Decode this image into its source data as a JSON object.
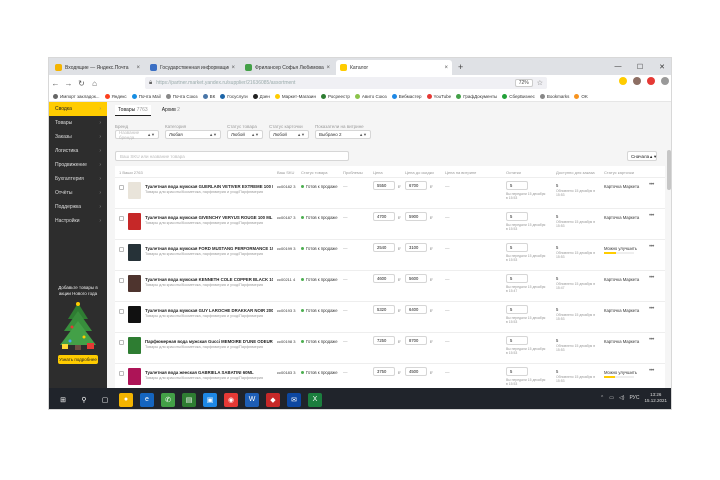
{
  "browser": {
    "tabs": [
      {
        "title": "Входящие — Яндекс.Почта",
        "color": "#f4b400"
      },
      {
        "title": "Государственная информационн",
        "color": "#3b6fc4"
      },
      {
        "title": "Фрилансер Софья Любимова",
        "color": "#43a047"
      },
      {
        "title": "Каталог",
        "color": "#ffcc00"
      }
    ],
    "new_tab": "+",
    "window_controls": [
      "—",
      "☐",
      "✕"
    ],
    "nav": {
      "back": "←",
      "forward": "→",
      "reload": "↻",
      "home": "⌂"
    },
    "url": "https://partner.market.yandex.ru/supplier/21636085/assortment",
    "zoom": "72%",
    "bookmarks": [
      {
        "label": "Импорт закладок...",
        "color": "#666"
      },
      {
        "label": "Яндекс",
        "color": "#fc3f1d"
      },
      {
        "label": "Почта Mail",
        "color": "#168de2"
      },
      {
        "label": "Почта Союз",
        "color": "#888"
      },
      {
        "label": "ВК",
        "color": "#4a76a8"
      },
      {
        "label": "Госуслуги",
        "color": "#1c65a8"
      },
      {
        "label": "Дзен",
        "color": "#222"
      },
      {
        "label": "Маркет-Магазин",
        "color": "#ffcc00"
      },
      {
        "label": "Росреестр",
        "color": "#2e7d32"
      },
      {
        "label": "Авито Союз",
        "color": "#8bc34a"
      },
      {
        "label": "Вебмастер",
        "color": "#1e88e5"
      },
      {
        "label": "YouTube",
        "color": "#e53935"
      },
      {
        "label": "ГрафДокументы",
        "color": "#43a047"
      },
      {
        "label": "СберБизнес",
        "color": "#21a038"
      },
      {
        "label": "Bookmarks",
        "color": "#888"
      },
      {
        "label": "OK",
        "color": "#f7931e"
      }
    ]
  },
  "sidebar": {
    "items": [
      {
        "label": "Сводка",
        "active": true
      },
      {
        "label": "Товары",
        "active": false
      },
      {
        "label": "Заказы",
        "active": false
      },
      {
        "label": "Логистика",
        "active": false
      },
      {
        "label": "Продвижение",
        "active": false
      },
      {
        "label": "Бухгалтерия",
        "active": false
      },
      {
        "label": "Отчёты",
        "active": false
      },
      {
        "label": "Поддержка",
        "active": false
      },
      {
        "label": "Настройки",
        "active": false
      }
    ],
    "promo_text": "Добавьте товары в акции Нового года",
    "promo_button": "Узнать подробнее"
  },
  "main": {
    "tabs": [
      {
        "label": "Товары",
        "count": "7763"
      },
      {
        "label": "Архив",
        "count": "2"
      }
    ],
    "filters": [
      {
        "label": "Бренд",
        "value": "Название бренда",
        "placeholder": true
      },
      {
        "label": "Категория",
        "value": "Любая",
        "placeholder": false
      },
      {
        "label": "Статус товара",
        "value": "Любой",
        "placeholder": false
      },
      {
        "label": "Статус карточки",
        "value": "Любой",
        "placeholder": false
      },
      {
        "label": "Показатели на витрине",
        "value": "Выбрано 2",
        "placeholder": false
      }
    ],
    "search_placeholder": "Ваш SKU или название товара",
    "sort": "Сначала",
    "columns": [
      "1 Ваши 2763",
      "Ваш SKU",
      "Статус товара",
      "Проблемы",
      "Цена",
      "Цена до скидки",
      "Цена на витрине",
      "Остатки",
      "Доступно для заказа",
      "Статус карточки"
    ],
    "rows": [
      {
        "name": "Туалетная вода мужская GUERLAIN VETIVER EXTREME 100 ML",
        "cat": "Товары для красоты/Косметика, парфюмерия и уход/Парфюмерия",
        "sku": "cc00182 3",
        "status": "Готов к продаже",
        "problem": "—",
        "price": "5550",
        "price_old": "6700",
        "rub": "₽",
        "qty": "—",
        "stock": "5",
        "stock_note": "Вы передали 15 декабря в 15:53",
        "avail": "5",
        "avail_note": "Обновлено 15 декабря в 15:53",
        "card": "Карточка Маркета",
        "progress": null,
        "thumb": "#e9e4da"
      },
      {
        "name": "Туалетная вода мужская GIVENCHY VERYUS ROUGE 100 ML",
        "cat": "Товары для красоты/Косметика, парфюмерия и уход/Парфюмерия",
        "sku": "cc00187 3",
        "status": "Готов к продаже",
        "problem": "—",
        "price": "4700",
        "price_old": "5900",
        "rub": "₽",
        "qty": "—",
        "stock": "5",
        "stock_note": "Вы передали 15 декабря в 15:53",
        "avail": "5",
        "avail_note": "Обновлено 15 декабря в 15:53",
        "card": "Карточка Маркета",
        "progress": null,
        "thumb": "#c62828"
      },
      {
        "name": "Туалетная вода мужская FORD MUSTANG PERFORMANCE 100 ML",
        "cat": "Товары для красоты/Косметика, парфюмерия и уход/Парфюмерия",
        "sku": "cc00199 3",
        "status": "Готов к продаже",
        "problem": "—",
        "price": "2540",
        "price_old": "3100",
        "rub": "₽",
        "qty": "—",
        "stock": "5",
        "stock_note": "Вы передали 15 декабря в 15:53",
        "avail": "5",
        "avail_note": "Обновлено 15 декабря в 15:53",
        "card": "Можно улучшить",
        "progress": 0.4,
        "thumb": "#263238"
      },
      {
        "name": "Туалетная вода мужская KENNETH COLE COPPER BLACK 100 ML",
        "cat": "Товары для красоты/Косметика, парфюмерия и уход/Парфюмерия",
        "sku": "cc00211 4",
        "status": "Готов к продаже",
        "problem": "—",
        "price": "4600",
        "price_old": "5600",
        "rub": "₽",
        "qty": "—",
        "stock": "5",
        "stock_note": "Вы передали 15 декабря в 15:47",
        "avail": "5",
        "avail_note": "Обновлено 15 декабря в 15:47",
        "card": "Карточка Маркета",
        "progress": null,
        "thumb": "#4e342e"
      },
      {
        "name": "Туалетная вода мужская GUY LAROCHE DRAKKAR NOIR 200 ML",
        "cat": "Товары для красоты/Косметика, парфюмерия и уход/Парфюмерия",
        "sku": "cc00193 3",
        "status": "Готов к продаже",
        "problem": "—",
        "price": "5320",
        "price_old": "6400",
        "rub": "₽",
        "qty": "—",
        "stock": "5",
        "stock_note": "Вы передали 15 декабря в 15:53",
        "avail": "5",
        "avail_note": "Обновлено 15 декабря в 15:53",
        "card": "Карточка Маркета",
        "progress": null,
        "thumb": "#111111"
      },
      {
        "name": "Парфюмерная вода мужская Gucci MEMOIRE D'UNE ODEUR 100ML",
        "cat": "Товары для красоты/Косметика, парфюмерия и уход/Парфюмерия",
        "sku": "cc00198 3",
        "status": "Готов к продаже",
        "problem": "—",
        "price": "7250",
        "price_old": "8700",
        "rub": "₽",
        "qty": "—",
        "stock": "5",
        "stock_note": "Вы передали 15 декабря в 15:53",
        "avail": "5",
        "avail_note": "Обновлено 15 декабря в 15:53",
        "card": "Карточка Маркета",
        "progress": null,
        "thumb": "#2e7d32"
      },
      {
        "name": "Туалетная вода женская GABRIELA SABATINI 60ML",
        "cat": "Товары для красоты/Косметика, парфюмерия и уход/Парфюмерия",
        "sku": "cc00183 3",
        "status": "Готов к продаже",
        "problem": "—",
        "price": "3750",
        "price_old": "4500",
        "rub": "₽",
        "qty": "—",
        "stock": "5",
        "stock_note": "Вы передали 15 декабря в 15:53",
        "avail": "5",
        "avail_note": "Обновлено 15 декабря в 15:53",
        "card": "Можно улучшить",
        "progress": 0.35,
        "thumb": "#ad1457"
      }
    ]
  },
  "taskbar": {
    "icons": [
      {
        "glyph": "⊞",
        "color": "transparent"
      },
      {
        "glyph": "⚲",
        "color": "transparent"
      },
      {
        "glyph": "▢",
        "color": "transparent"
      },
      {
        "glyph": "●",
        "color": "#f4b400"
      },
      {
        "glyph": "e",
        "color": "#1565c0"
      },
      {
        "glyph": "✆",
        "color": "#43a047"
      },
      {
        "glyph": "▤",
        "color": "#2e7d32"
      },
      {
        "glyph": "▣",
        "color": "#1e88e5"
      },
      {
        "glyph": "◉",
        "color": "#e53935"
      },
      {
        "glyph": "W",
        "color": "#1e5eb5"
      },
      {
        "glyph": "◆",
        "color": "#c62828"
      },
      {
        "glyph": "✉",
        "color": "#0d47a1"
      },
      {
        "glyph": "X",
        "color": "#1b7e3e"
      }
    ],
    "lang": "РУС",
    "time": "13:26",
    "date": "15.12.2021"
  }
}
